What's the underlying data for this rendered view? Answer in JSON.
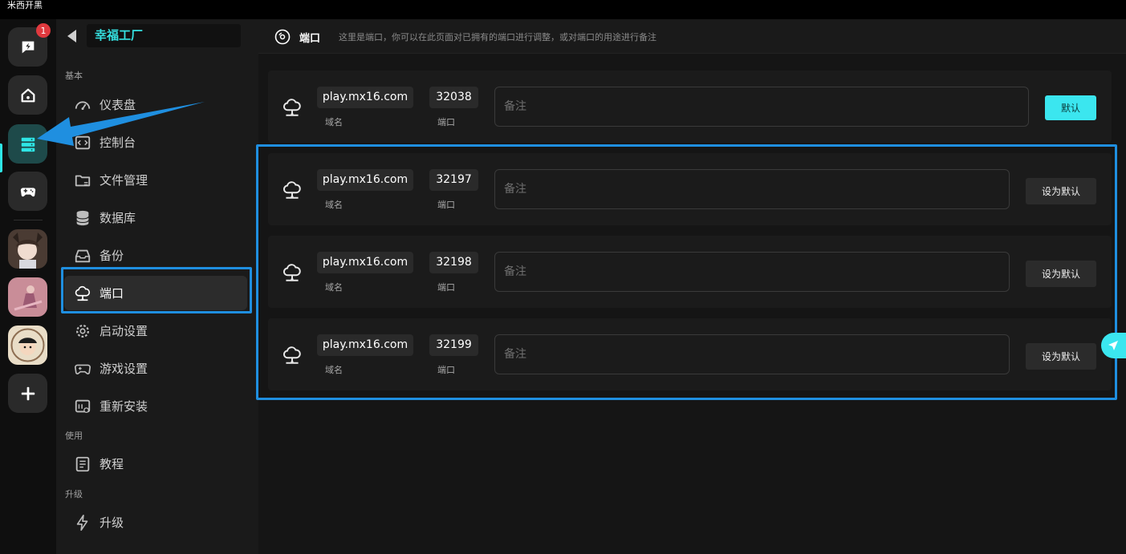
{
  "app_title": "米西开黑",
  "rail": {
    "notification_count": "1",
    "colors": {
      "active_bg": "#1e4a4a",
      "accent": "#2ee6e6",
      "badge": "#e0393e"
    }
  },
  "nav": {
    "server_name": "幸福工厂",
    "sections": {
      "basic": "基本",
      "usage": "使用",
      "upgrade": "升级"
    },
    "items": {
      "dashboard": "仪表盘",
      "console": "控制台",
      "files": "文件管理",
      "database": "数据库",
      "backup": "备份",
      "ports": "端口",
      "startup": "启动设置",
      "game_settings": "游戏设置",
      "reinstall": "重新安装",
      "tutorial": "教程",
      "upgrade": "升级"
    }
  },
  "main": {
    "title": "端口",
    "description": "这里是端口，你可以在此页面对已拥有的端口进行调整，或对端口的用途进行备注",
    "domain_label": "域名",
    "port_label": "端口",
    "note_placeholder": "备注",
    "default_label": "默认",
    "set_default_label": "设为默认",
    "ports": [
      {
        "domain": "play.mx16.com",
        "port": "32038",
        "is_default": true
      },
      {
        "domain": "play.mx16.com",
        "port": "32197",
        "is_default": false
      },
      {
        "domain": "play.mx16.com",
        "port": "32198",
        "is_default": false
      },
      {
        "domain": "play.mx16.com",
        "port": "32199",
        "is_default": false
      }
    ]
  },
  "colors": {
    "accent": "#3be6ef",
    "highlight": "#1f8fe0",
    "server_name": "#35e0e0"
  }
}
